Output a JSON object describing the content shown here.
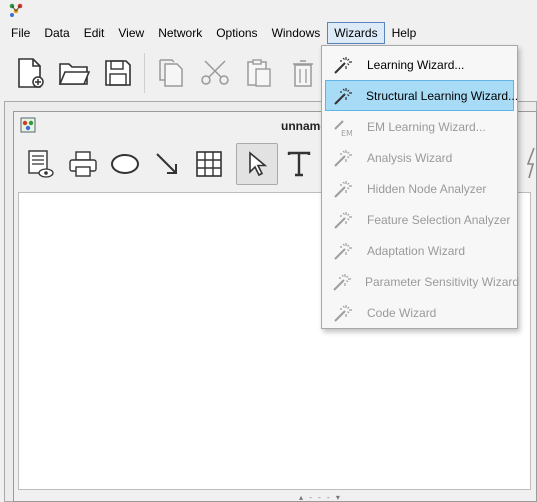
{
  "menubar": {
    "items": [
      "File",
      "Data",
      "Edit",
      "View",
      "Network",
      "Options",
      "Windows",
      "Wizards",
      "Help"
    ],
    "open": "Wizards"
  },
  "main_toolbar": {
    "icons": [
      "new-file-icon",
      "open-folder-icon",
      "save-icon",
      "copy-icon",
      "cut-icon",
      "paste-icon",
      "delete-icon"
    ]
  },
  "document_window": {
    "title": "unnamed",
    "toolbar_icons": [
      "properties-view-icon",
      "print-icon",
      "ellipse-node-icon",
      "arrow-link-icon",
      "table-icon",
      "select-pointer-icon",
      "text-tool-icon"
    ]
  },
  "wizards_menu": {
    "items": [
      {
        "label": "Learning Wizard...",
        "enabled": true,
        "highlighted": false
      },
      {
        "label": "Structural Learning Wizard...",
        "enabled": true,
        "highlighted": true
      },
      {
        "label": "EM Learning Wizard...",
        "enabled": false,
        "highlighted": false
      },
      {
        "label": "Analysis Wizard",
        "enabled": false,
        "highlighted": false
      },
      {
        "label": "Hidden Node Analyzer",
        "enabled": false,
        "highlighted": false
      },
      {
        "label": "Feature Selection Analyzer",
        "enabled": false,
        "highlighted": false
      },
      {
        "label": "Adaptation Wizard",
        "enabled": false,
        "highlighted": false
      },
      {
        "label": "Parameter Sensitivity Wizard",
        "enabled": false,
        "highlighted": false
      },
      {
        "label": "Code Wizard",
        "enabled": false,
        "highlighted": false
      }
    ]
  },
  "colors": {
    "menu_highlight": "#a7dbf6",
    "menu_open": "#ddeaf8",
    "disabled_text": "#9a9a9a"
  }
}
